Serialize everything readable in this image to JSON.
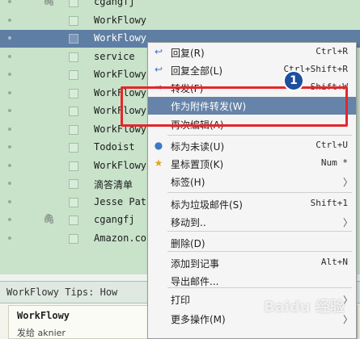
{
  "mail_list": {
    "rows": [
      {
        "sender": "cgangfj",
        "attachment": true,
        "selected": false
      },
      {
        "sender": "WorkFlowy",
        "attachment": false,
        "selected": false
      },
      {
        "sender": "WorkFlowy",
        "attachment": false,
        "selected": true
      },
      {
        "sender": "service",
        "attachment": false,
        "selected": false
      },
      {
        "sender": "WorkFlowy",
        "attachment": false,
        "selected": false
      },
      {
        "sender": "WorkFlowy",
        "attachment": false,
        "selected": false
      },
      {
        "sender": "WorkFlowy",
        "attachment": false,
        "selected": false
      },
      {
        "sender": "WorkFlowy",
        "attachment": false,
        "selected": false
      },
      {
        "sender": "Todoist",
        "attachment": false,
        "selected": false
      },
      {
        "sender": "WorkFlowy",
        "attachment": false,
        "selected": false
      },
      {
        "sender": "滴答清单",
        "attachment": false,
        "selected": false
      },
      {
        "sender": "Jesse Pat",
        "attachment": false,
        "selected": false
      },
      {
        "sender": "cgangfj",
        "attachment": true,
        "selected": false
      },
      {
        "sender": "Amazon.co",
        "attachment": false,
        "selected": false
      }
    ]
  },
  "preview": {
    "title": "WorkFlowy Tips: How",
    "from": "WorkFlowy",
    "to": "发给 aknier"
  },
  "context_menu": {
    "items": [
      {
        "label": "回复(R)",
        "shortcut": "Ctrl+R",
        "icon": "reply-icon",
        "icon_glyph": "↩"
      },
      {
        "label": "回复全部(L)",
        "shortcut": "Ctrl+Shift+R",
        "icon": "reply-all-icon",
        "icon_glyph": "↩"
      },
      {
        "label": "转发(F)",
        "shortcut": "Shift+W",
        "icon": "forward-icon",
        "icon_glyph": "➡"
      },
      {
        "label": "作为附件转发(W)",
        "shortcut": "",
        "icon": "",
        "icon_glyph": "",
        "highlighted": true
      },
      {
        "label": "再次编辑(A)",
        "shortcut": "",
        "icon": "",
        "icon_glyph": ""
      },
      {
        "label": "标为未读(U)",
        "shortcut": "Ctrl+U",
        "icon": "unread-dot-icon",
        "icon_glyph": "●"
      },
      {
        "label": "星标置顶(K)",
        "shortcut": "Num *",
        "icon": "star-icon",
        "icon_glyph": "★"
      },
      {
        "label": "标签(H)",
        "shortcut": "",
        "submenu": true
      },
      {
        "label": "标为垃圾邮件(S)",
        "shortcut": "Shift+1"
      },
      {
        "label": "移动到..",
        "shortcut": "",
        "submenu": true
      },
      {
        "label": "删除(D)",
        "shortcut": ""
      },
      {
        "label": "添加到记事",
        "shortcut": "Alt+N"
      },
      {
        "label": "导出邮件...",
        "shortcut": ""
      },
      {
        "label": "打印",
        "shortcut": "",
        "submenu": true
      },
      {
        "label": "更多操作(M)",
        "shortcut": "",
        "submenu": true
      }
    ]
  },
  "annotation": {
    "badge_number": "1"
  },
  "watermark": "Baidu 经验",
  "colors": {
    "list_bg": "#c9e3cb",
    "selected_row": "#5f7ea4",
    "menu_highlight": "#6683a9",
    "callout_red": "#e5262b",
    "badge_blue": "#1d4f9e",
    "icon_blue": "#3c78c8",
    "star_orange": "#e8a020"
  }
}
